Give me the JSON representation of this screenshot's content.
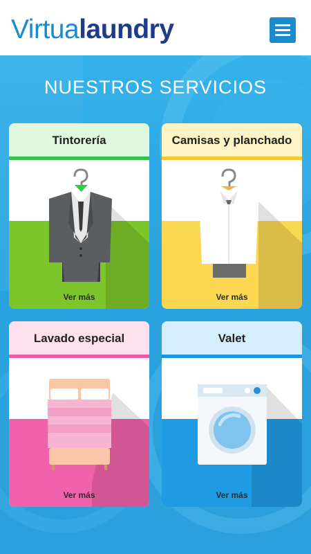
{
  "header": {
    "logo_part1": "Virtua",
    "logo_part2": "laundry",
    "menu_icon": "hamburger-menu-icon"
  },
  "section": {
    "title": "NUESTROS SERVICIOS"
  },
  "colors": {
    "brand_blue": "#1a8ccd",
    "brand_navy": "#1f3c88",
    "background_blue": "#2aa6e2"
  },
  "services": [
    {
      "title": "Tintorería",
      "link": "Ver más",
      "icon": "suit-on-hanger-icon",
      "head_color": "#dff7dc",
      "bar_color": "#35c24a",
      "accent": "#7cc52b"
    },
    {
      "title": "Camisas y planchado",
      "link": "Ver más",
      "icon": "shirt-on-hanger-icon",
      "head_color": "#fdf3c4",
      "bar_color": "#f7c92e",
      "accent": "#fbd752"
    },
    {
      "title": "Lavado especial",
      "link": "Ver más",
      "icon": "bed-icon",
      "head_color": "#fde0ec",
      "bar_color": "#f05aa5",
      "accent": "#f062ab"
    },
    {
      "title": "Valet",
      "link": "Ver más",
      "icon": "washing-machine-icon",
      "head_color": "#d5eefc",
      "bar_color": "#1b95e0",
      "accent": "#1f9be3"
    }
  ]
}
